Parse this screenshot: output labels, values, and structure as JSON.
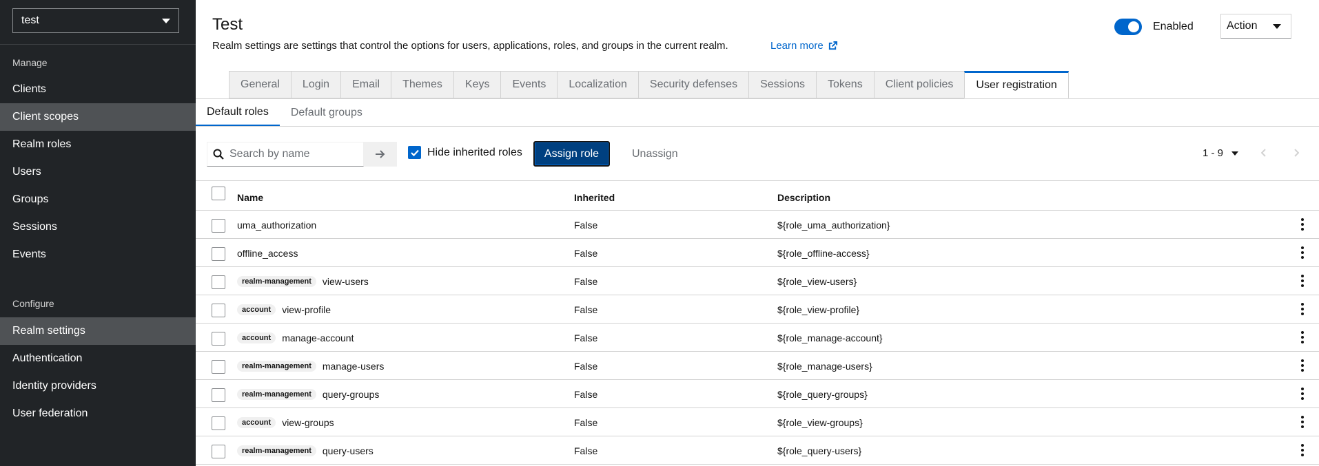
{
  "sidebar": {
    "realm": "test",
    "sections": {
      "manage": "Manage",
      "configure": "Configure"
    },
    "manage_items": [
      "Clients",
      "Client scopes",
      "Realm roles",
      "Users",
      "Groups",
      "Sessions",
      "Events"
    ],
    "configure_items": [
      "Realm settings",
      "Authentication",
      "Identity providers",
      "User federation"
    ],
    "active_item": "Realm settings",
    "hover_item": "Client scopes"
  },
  "header": {
    "title": "Test",
    "description": "Realm settings are settings that control the options for users, applications, roles, and groups in the current realm.",
    "learn_more": "Learn more",
    "enabled_label": "Enabled",
    "enabled": true,
    "action_label": "Action"
  },
  "tabs": [
    "General",
    "Login",
    "Email",
    "Themes",
    "Keys",
    "Events",
    "Localization",
    "Security defenses",
    "Sessions",
    "Tokens",
    "Client policies",
    "User registration"
  ],
  "active_tab": "User registration",
  "subtabs": [
    "Default roles",
    "Default groups"
  ],
  "active_subtab": "Default roles",
  "toolbar": {
    "search_placeholder": "Search by name",
    "hide_inherited_label": "Hide inherited roles",
    "hide_inherited_checked": true,
    "assign_label": "Assign role",
    "unassign_label": "Unassign",
    "pagination": "1 - 9"
  },
  "table": {
    "columns": {
      "name": "Name",
      "inherited": "Inherited",
      "description": "Description"
    },
    "rows": [
      {
        "client": "",
        "name": "uma_authorization",
        "inherited": "False",
        "description": "${role_uma_authorization}"
      },
      {
        "client": "",
        "name": "offline_access",
        "inherited": "False",
        "description": "${role_offline-access}"
      },
      {
        "client": "realm-management",
        "name": "view-users",
        "inherited": "False",
        "description": "${role_view-users}"
      },
      {
        "client": "account",
        "name": "view-profile",
        "inherited": "False",
        "description": "${role_view-profile}"
      },
      {
        "client": "account",
        "name": "manage-account",
        "inherited": "False",
        "description": "${role_manage-account}"
      },
      {
        "client": "realm-management",
        "name": "manage-users",
        "inherited": "False",
        "description": "${role_manage-users}"
      },
      {
        "client": "realm-management",
        "name": "query-groups",
        "inherited": "False",
        "description": "${role_query-groups}"
      },
      {
        "client": "account",
        "name": "view-groups",
        "inherited": "False",
        "description": "${role_view-groups}"
      },
      {
        "client": "realm-management",
        "name": "query-users",
        "inherited": "False",
        "description": "${role_query-users}"
      }
    ]
  },
  "colors": {
    "accent": "#0066cc",
    "sidebar_bg": "#212427",
    "primary_button": "#004080"
  }
}
